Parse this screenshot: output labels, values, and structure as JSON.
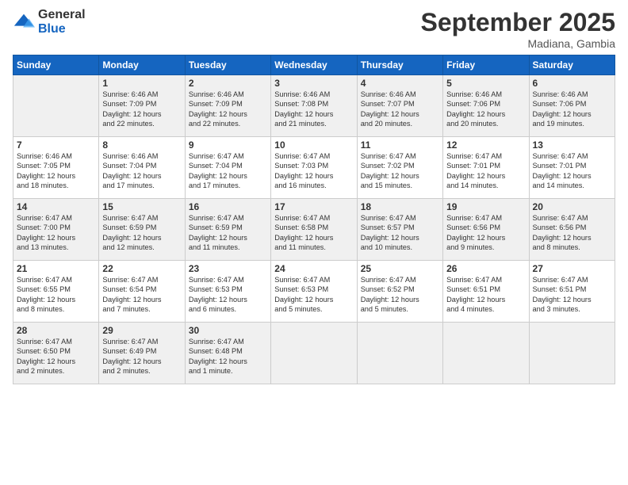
{
  "logo": {
    "general": "General",
    "blue": "Blue"
  },
  "title": {
    "month": "September 2025",
    "location": "Madiana, Gambia"
  },
  "headers": [
    "Sunday",
    "Monday",
    "Tuesday",
    "Wednesday",
    "Thursday",
    "Friday",
    "Saturday"
  ],
  "weeks": [
    [
      {
        "day": "",
        "info": ""
      },
      {
        "day": "1",
        "info": "Sunrise: 6:46 AM\nSunset: 7:09 PM\nDaylight: 12 hours\nand 22 minutes."
      },
      {
        "day": "2",
        "info": "Sunrise: 6:46 AM\nSunset: 7:09 PM\nDaylight: 12 hours\nand 22 minutes."
      },
      {
        "day": "3",
        "info": "Sunrise: 6:46 AM\nSunset: 7:08 PM\nDaylight: 12 hours\nand 21 minutes."
      },
      {
        "day": "4",
        "info": "Sunrise: 6:46 AM\nSunset: 7:07 PM\nDaylight: 12 hours\nand 20 minutes."
      },
      {
        "day": "5",
        "info": "Sunrise: 6:46 AM\nSunset: 7:06 PM\nDaylight: 12 hours\nand 20 minutes."
      },
      {
        "day": "6",
        "info": "Sunrise: 6:46 AM\nSunset: 7:06 PM\nDaylight: 12 hours\nand 19 minutes."
      }
    ],
    [
      {
        "day": "7",
        "info": "Sunrise: 6:46 AM\nSunset: 7:05 PM\nDaylight: 12 hours\nand 18 minutes."
      },
      {
        "day": "8",
        "info": "Sunrise: 6:46 AM\nSunset: 7:04 PM\nDaylight: 12 hours\nand 17 minutes."
      },
      {
        "day": "9",
        "info": "Sunrise: 6:47 AM\nSunset: 7:04 PM\nDaylight: 12 hours\nand 17 minutes."
      },
      {
        "day": "10",
        "info": "Sunrise: 6:47 AM\nSunset: 7:03 PM\nDaylight: 12 hours\nand 16 minutes."
      },
      {
        "day": "11",
        "info": "Sunrise: 6:47 AM\nSunset: 7:02 PM\nDaylight: 12 hours\nand 15 minutes."
      },
      {
        "day": "12",
        "info": "Sunrise: 6:47 AM\nSunset: 7:01 PM\nDaylight: 12 hours\nand 14 minutes."
      },
      {
        "day": "13",
        "info": "Sunrise: 6:47 AM\nSunset: 7:01 PM\nDaylight: 12 hours\nand 14 minutes."
      }
    ],
    [
      {
        "day": "14",
        "info": "Sunrise: 6:47 AM\nSunset: 7:00 PM\nDaylight: 12 hours\nand 13 minutes."
      },
      {
        "day": "15",
        "info": "Sunrise: 6:47 AM\nSunset: 6:59 PM\nDaylight: 12 hours\nand 12 minutes."
      },
      {
        "day": "16",
        "info": "Sunrise: 6:47 AM\nSunset: 6:59 PM\nDaylight: 12 hours\nand 11 minutes."
      },
      {
        "day": "17",
        "info": "Sunrise: 6:47 AM\nSunset: 6:58 PM\nDaylight: 12 hours\nand 11 minutes."
      },
      {
        "day": "18",
        "info": "Sunrise: 6:47 AM\nSunset: 6:57 PM\nDaylight: 12 hours\nand 10 minutes."
      },
      {
        "day": "19",
        "info": "Sunrise: 6:47 AM\nSunset: 6:56 PM\nDaylight: 12 hours\nand 9 minutes."
      },
      {
        "day": "20",
        "info": "Sunrise: 6:47 AM\nSunset: 6:56 PM\nDaylight: 12 hours\nand 8 minutes."
      }
    ],
    [
      {
        "day": "21",
        "info": "Sunrise: 6:47 AM\nSunset: 6:55 PM\nDaylight: 12 hours\nand 8 minutes."
      },
      {
        "day": "22",
        "info": "Sunrise: 6:47 AM\nSunset: 6:54 PM\nDaylight: 12 hours\nand 7 minutes."
      },
      {
        "day": "23",
        "info": "Sunrise: 6:47 AM\nSunset: 6:53 PM\nDaylight: 12 hours\nand 6 minutes."
      },
      {
        "day": "24",
        "info": "Sunrise: 6:47 AM\nSunset: 6:53 PM\nDaylight: 12 hours\nand 5 minutes."
      },
      {
        "day": "25",
        "info": "Sunrise: 6:47 AM\nSunset: 6:52 PM\nDaylight: 12 hours\nand 5 minutes."
      },
      {
        "day": "26",
        "info": "Sunrise: 6:47 AM\nSunset: 6:51 PM\nDaylight: 12 hours\nand 4 minutes."
      },
      {
        "day": "27",
        "info": "Sunrise: 6:47 AM\nSunset: 6:51 PM\nDaylight: 12 hours\nand 3 minutes."
      }
    ],
    [
      {
        "day": "28",
        "info": "Sunrise: 6:47 AM\nSunset: 6:50 PM\nDaylight: 12 hours\nand 2 minutes."
      },
      {
        "day": "29",
        "info": "Sunrise: 6:47 AM\nSunset: 6:49 PM\nDaylight: 12 hours\nand 2 minutes."
      },
      {
        "day": "30",
        "info": "Sunrise: 6:47 AM\nSunset: 6:48 PM\nDaylight: 12 hours\nand 1 minute."
      },
      {
        "day": "",
        "info": ""
      },
      {
        "day": "",
        "info": ""
      },
      {
        "day": "",
        "info": ""
      },
      {
        "day": "",
        "info": ""
      }
    ]
  ]
}
